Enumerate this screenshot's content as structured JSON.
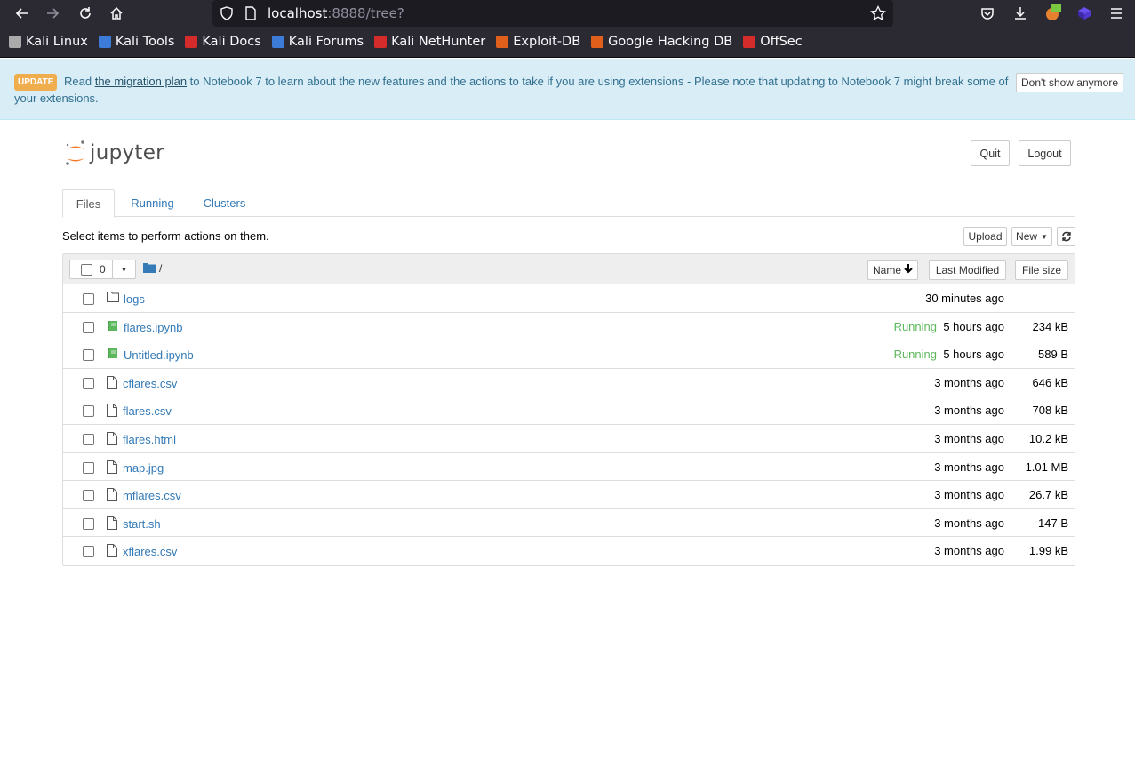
{
  "browser": {
    "url_host": "localhost",
    "url_path": ":8888/tree?",
    "bookmarks": [
      {
        "label": "Kali Linux",
        "color": "#aaaaaa"
      },
      {
        "label": "Kali Tools",
        "color": "#3d7bd9"
      },
      {
        "label": "Kali Docs",
        "color": "#d42b2b"
      },
      {
        "label": "Kali Forums",
        "color": "#3d7bd9"
      },
      {
        "label": "Kali NetHunter",
        "color": "#d42b2b"
      },
      {
        "label": "Exploit-DB",
        "color": "#e0601b"
      },
      {
        "label": "Google Hacking DB",
        "color": "#e0601b"
      },
      {
        "label": "OffSec",
        "color": "#d42b2b"
      }
    ]
  },
  "banner": {
    "badge": "UPDATE",
    "text_before": "Read ",
    "link": "the migration plan",
    "text_after": " to Notebook 7 to learn about the new features and the actions to take if you are using extensions - Please note that updating to Notebook 7 might break some of your extensions.",
    "dismiss": "Don't show anymore"
  },
  "header": {
    "logo_text": "jupyter",
    "quit": "Quit",
    "logout": "Logout"
  },
  "tabs": [
    "Files",
    "Running",
    "Clusters"
  ],
  "select_message": "Select items to perform actions on them.",
  "actions": {
    "upload": "Upload",
    "new": "New"
  },
  "list_header": {
    "count": "0",
    "path": "/",
    "name": "Name",
    "last_modified": "Last Modified",
    "file_size": "File size"
  },
  "files": [
    {
      "name": "logs",
      "type": "folder",
      "status": "",
      "modified": "30 minutes ago",
      "size": ""
    },
    {
      "name": "flares.ipynb",
      "type": "notebook",
      "status": "Running",
      "modified": "5 hours ago",
      "size": "234 kB"
    },
    {
      "name": "Untitled.ipynb",
      "type": "notebook",
      "status": "Running",
      "modified": "5 hours ago",
      "size": "589 B"
    },
    {
      "name": "cflares.csv",
      "type": "file",
      "status": "",
      "modified": "3 months ago",
      "size": "646 kB"
    },
    {
      "name": "flares.csv",
      "type": "file",
      "status": "",
      "modified": "3 months ago",
      "size": "708 kB"
    },
    {
      "name": "flares.html",
      "type": "file",
      "status": "",
      "modified": "3 months ago",
      "size": "10.2 kB"
    },
    {
      "name": "map.jpg",
      "type": "file",
      "status": "",
      "modified": "3 months ago",
      "size": "1.01 MB"
    },
    {
      "name": "mflares.csv",
      "type": "file",
      "status": "",
      "modified": "3 months ago",
      "size": "26.7 kB"
    },
    {
      "name": "start.sh",
      "type": "file",
      "status": "",
      "modified": "3 months ago",
      "size": "147 B"
    },
    {
      "name": "xflares.csv",
      "type": "file",
      "status": "",
      "modified": "3 months ago",
      "size": "1.99 kB"
    }
  ]
}
